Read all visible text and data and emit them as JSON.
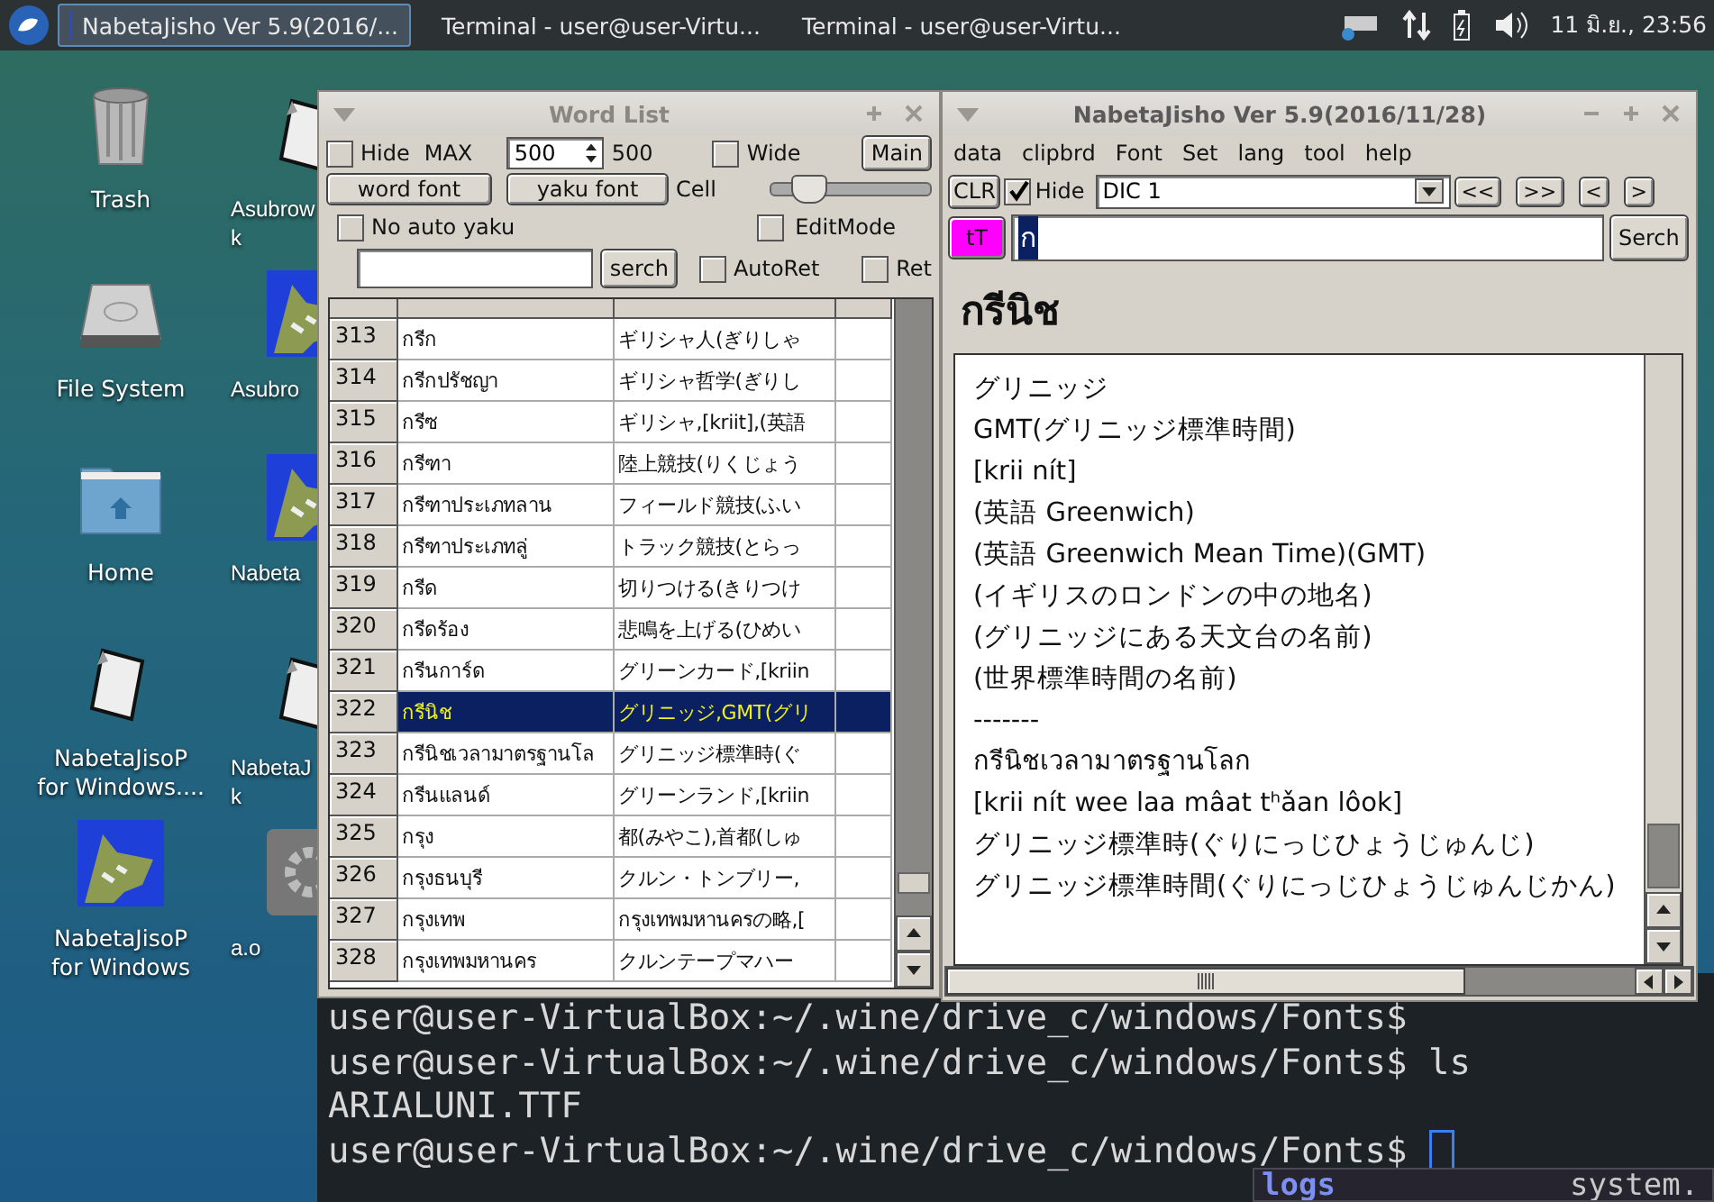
{
  "taskbar": {
    "tasks": [
      {
        "kind": "app",
        "label": "NabetaJisho Ver 5.9(2016/...",
        "selected": true
      },
      {
        "kind": "terminal",
        "label": "Terminal - user@user-Virtu...",
        "selected": false
      },
      {
        "kind": "terminal",
        "label": "Terminal - user@user-Virtu...",
        "selected": false
      }
    ],
    "clock": "11 มิ.ย., 23:56"
  },
  "desktop": {
    "column_1": [
      {
        "kind": "trash",
        "lines": [
          "Trash"
        ]
      },
      {
        "kind": "drive",
        "lines": [
          "File System"
        ]
      },
      {
        "kind": "folder",
        "lines": [
          "Home"
        ]
      },
      {
        "kind": "file",
        "lines": [
          "NabetaJisoP",
          "for Windows...."
        ]
      },
      {
        "kind": "picture",
        "lines": [
          "NabetaJisoP",
          "for Windows"
        ]
      }
    ],
    "column_2": [
      {
        "kind": "file",
        "lines": [
          "Asubrow",
          "k"
        ]
      },
      {
        "kind": "picture",
        "lines": [
          "Asubro"
        ]
      },
      {
        "kind": "picture",
        "lines": [
          "Nabeta"
        ]
      },
      {
        "kind": "file",
        "lines": [
          "NabetaJ",
          "k"
        ]
      },
      {
        "kind": "gear",
        "lines": [
          "a.o"
        ]
      }
    ]
  },
  "terminal": {
    "lines": [
      "user@user-VirtualBox:~/.wine/drive_c/windows/Fonts$",
      "user@user-VirtualBox:~/.wine/drive_c/windows/Fonts$ ls",
      "ARIALUNI.TTF",
      "user@user-VirtualBox:~/.wine/drive_c/windows/Fonts$"
    ]
  },
  "terminal_2": {
    "lines": [
      "logs",
      "system."
    ]
  },
  "word_list": {
    "title": "Word List",
    "hide": {
      "label": "Hide",
      "checked": false
    },
    "max_label": "MAX",
    "max_value": "500",
    "max_reading": "500",
    "wide": {
      "label": "Wide",
      "checked": false
    },
    "main_button": "Main",
    "word_font_button": "word font",
    "yaku_font_button": "yaku font",
    "cell_label": "Cell",
    "cell_slider": {
      "level": 0.15
    },
    "no_auto_yaku": {
      "label": "No auto yaku",
      "checked": false
    },
    "edit_mode": {
      "label": "EditMode",
      "checked": false
    },
    "search_button": "serch",
    "auto_ret": {
      "label": "AutoRet",
      "checked": false
    },
    "ret": {
      "label": "Ret",
      "checked": false
    },
    "rows": [
      {
        "number": "313",
        "word": "กรีก",
        "yaku": "ギリシャ人(ぎりしゃ",
        "selected": false
      },
      {
        "number": "314",
        "word": "กรีกปรัชญา",
        "yaku": "ギリシャ哲学(ぎりし",
        "selected": false
      },
      {
        "number": "315",
        "word": "กรีซ",
        "yaku": "ギリシャ,[kriit],(英語",
        "selected": false
      },
      {
        "number": "316",
        "word": "กรีฑา",
        "yaku": "陸上競技(りくじょう",
        "selected": false
      },
      {
        "number": "317",
        "word": "กรีฑาประเภทลาน",
        "yaku": "フィールド競技(ふい",
        "selected": false
      },
      {
        "number": "318",
        "word": "กรีฑาประเภทลู่",
        "yaku": "トラック競技(とらっ",
        "selected": false
      },
      {
        "number": "319",
        "word": "กรีด",
        "yaku": "切りつける(きりつけ",
        "selected": false
      },
      {
        "number": "320",
        "word": "กรีดร้อง",
        "yaku": "悲鳴を上げる(ひめい",
        "selected": false
      },
      {
        "number": "321",
        "word": "กรีนการ์ด",
        "yaku": "グリーンカード,[kriin",
        "selected": false
      },
      {
        "number": "322",
        "word": "กรีนิช",
        "yaku": "グリニッジ,GMT(グリ",
        "selected": true
      },
      {
        "number": "323",
        "word": "กรีนิชเวลามาตรฐานโล",
        "yaku": "グリニッジ標準時(ぐ",
        "selected": false
      },
      {
        "number": "324",
        "word": "กรีนแลนด์",
        "yaku": "グリーンランド,[kriin",
        "selected": false
      },
      {
        "number": "325",
        "word": "กรุง",
        "yaku": "都(みやこ),首都(しゅ",
        "selected": false
      },
      {
        "number": "326",
        "word": "กรุงธนบุรี",
        "yaku": "クルン・トンブリー,",
        "selected": false
      },
      {
        "number": "327",
        "word": "กรุงเทพ",
        "yaku": "กรุงเทพมหานครの略,[",
        "selected": false
      },
      {
        "number": "328",
        "word": "กรุงเทพมหานคร",
        "yaku": "クルンテープマハー",
        "selected": false
      }
    ]
  },
  "main_window": {
    "title": "NabetaJisho Ver 5.9(2016/11/28)",
    "menu": [
      "data",
      "clipbrd",
      "Font",
      "Set",
      "lang",
      "tool",
      "help"
    ],
    "clear_button": "CLR",
    "hide": {
      "label": "Hide",
      "checked": true
    },
    "dictionary": "DIC 1",
    "nav_buttons": [
      "<<",
      ">>",
      "<",
      ">"
    ],
    "case_button": "tT",
    "search_value": "ก",
    "search_button": "Serch",
    "headword": "กรีนิช",
    "definition": [
      "グリニッジ",
      "GMT(グリニッジ標準時間)",
      "[krii nít]",
      "(英語 Greenwich)",
      "(英語 Greenwich Mean Time)(GMT)",
      "(イギリスのロンドンの中の地名)",
      "(グリニッジにある天文台の名前)",
      "(世界標準時間の名前)",
      "-------",
      "กรีนิชเวลามาตรฐานโลก",
      "[krii nít wee laa mâat tʰǎan lôok]",
      "グリニッジ標準時(ぐりにっじひょうじゅんじ)",
      "グリニッジ標準時間(ぐりにっじひょうじゅんじかん)"
    ]
  }
}
